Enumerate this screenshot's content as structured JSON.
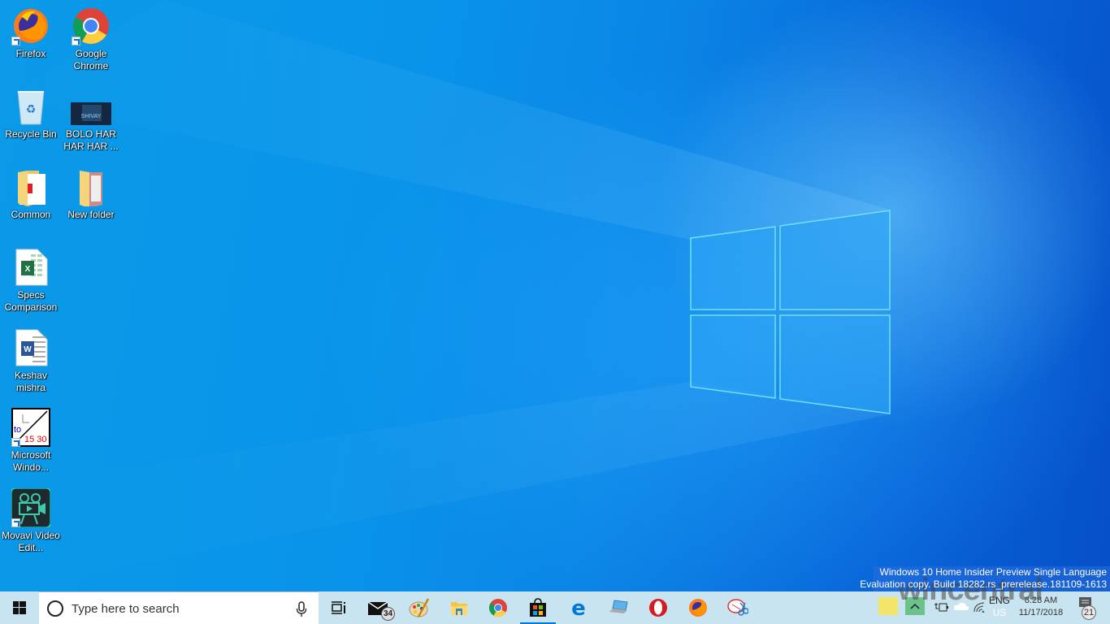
{
  "desktop": {
    "icons": [
      {
        "label": "Firefox",
        "icon": "firefox-icon",
        "shortcut": true
      },
      {
        "label": "Google Chrome",
        "icon": "chrome-icon",
        "shortcut": true
      },
      {
        "label": "Recycle Bin",
        "icon": "recycle-bin-icon",
        "shortcut": false
      },
      {
        "label": "BOLO HAR HAR HAR ...",
        "icon": "video-thumbnail-icon",
        "shortcut": false
      },
      {
        "label": "Common",
        "icon": "folder-icon",
        "shortcut": false
      },
      {
        "label": "New folder",
        "icon": "folder-icon",
        "shortcut": false
      },
      {
        "label": "Specs Comparison",
        "icon": "excel-file-icon",
        "shortcut": false
      },
      {
        "label": "Keshav mishra",
        "icon": "word-file-icon",
        "shortcut": false
      },
      {
        "label": "Microsoft Windo...",
        "icon": "angle-tool-icon",
        "shortcut": true
      },
      {
        "label": "Movavi Video Edit...",
        "icon": "movavi-icon",
        "shortcut": true
      }
    ],
    "wallpaper_colors": {
      "light": "#0a9ae8",
      "dark": "#0650c8",
      "logo": "#3cb4ff"
    }
  },
  "taskbar": {
    "search_placeholder": "Type here to search",
    "pinned": [
      {
        "name": "task-view",
        "label": "Task View"
      },
      {
        "name": "mail",
        "label": "Mail",
        "badge": "34"
      },
      {
        "name": "paint",
        "label": "Paint"
      },
      {
        "name": "file-explorer",
        "label": "File Explorer"
      },
      {
        "name": "chrome",
        "label": "Google Chrome"
      },
      {
        "name": "store",
        "label": "Microsoft Store",
        "active": true
      },
      {
        "name": "edge",
        "label": "Microsoft Edge"
      },
      {
        "name": "this-pc",
        "label": "This PC"
      },
      {
        "name": "opera",
        "label": "Opera"
      },
      {
        "name": "firefox",
        "label": "Firefox"
      },
      {
        "name": "snipping-tool",
        "label": "Snipping Tool"
      }
    ],
    "tray": {
      "language": "ENG",
      "region": "US",
      "time": "8:28 AM",
      "date": "11/17/2018",
      "notifications": "21"
    }
  },
  "watermark": {
    "line1": "Windows 10 Home Insider Preview Single Language",
    "line2": "Evaluation copy. Build 18282.rs_prerelease.181109-1613",
    "brand": "wincentral"
  },
  "accent": "#0078d7"
}
